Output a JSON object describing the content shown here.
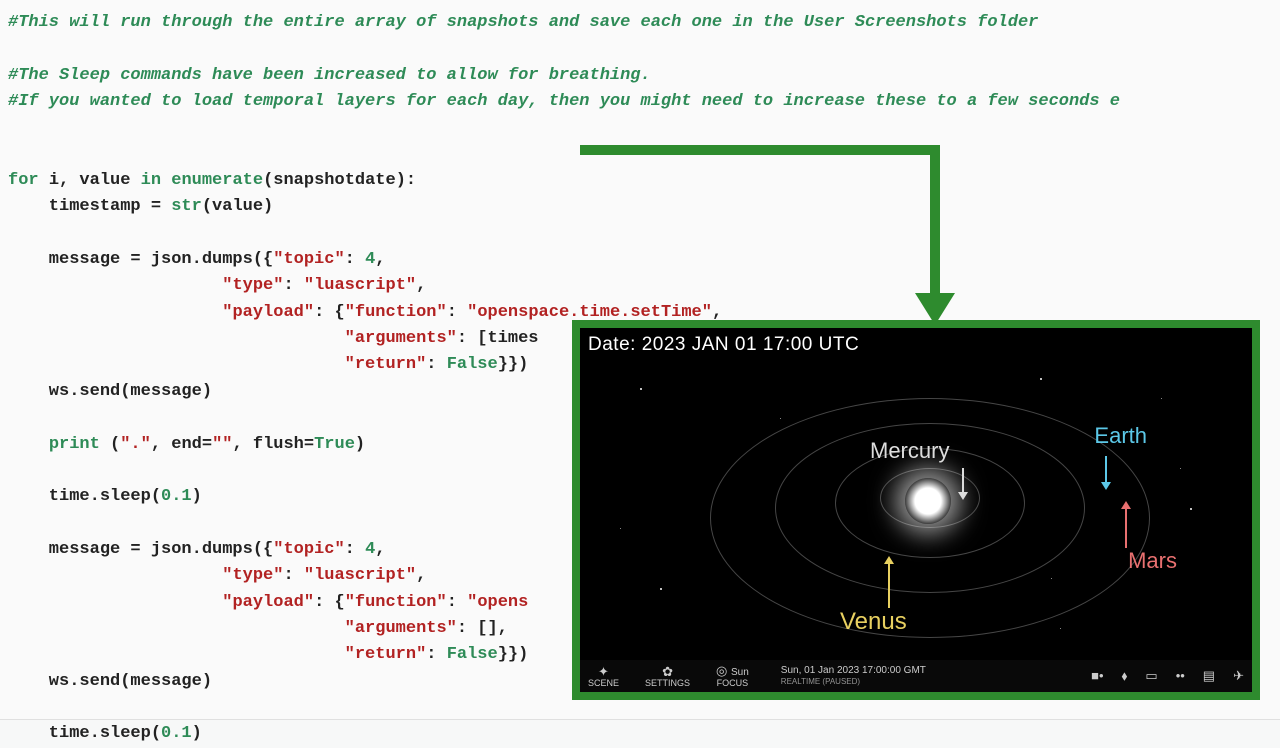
{
  "comments": {
    "c1": "#This will run through the entire array of snapshots and save each one in the User Screenshots folder",
    "c2": "#The Sleep commands have been increased to allow for breathing.",
    "c3": "#If you wanted to load temporal layers for each day, then you might need to increase these to a few seconds e"
  },
  "code": {
    "for_kw": "for",
    "i": "i",
    "comma": ",",
    "value": "value",
    "in_kw": "in",
    "enumerate": "enumerate",
    "snapshotdate": "(snapshotdate):",
    "timestamp_line": "    timestamp = ",
    "str_fn": "str",
    "value_call": "(value)",
    "msg1_a": "    message = json.dumps({",
    "topic_key": "\"topic\"",
    "colon": ": ",
    "four": "4",
    "comma_nl": ",",
    "type_key": "\"type\"",
    "luascript": "\"luascript\"",
    "payload_key": "\"payload\"",
    "function_key": "\"function\"",
    "setTime": "\"openspace.time.setTime\"",
    "arguments_key": "\"arguments\"",
    "timest_frag": ": [times",
    "return_key": "\"return\"",
    "false_kw": "False",
    "close1": "}})",
    "ws_send": "    ws.send(message)",
    "print_a": "    ",
    "print_fn": "print",
    "print_args_a": " (",
    "dot": "\".\"",
    "end_kw": ", end=",
    "empty": "\"\"",
    "flush_kw": ", flush=",
    "true_kw": "True",
    "print_close": ")",
    "sleep_a": "    time.sleep(",
    "sleep_val": "0.1",
    "sleep_close": ")",
    "opensp_frag": "\"opens",
    "args_empty": ": [],"
  },
  "preview": {
    "date_stamp": "Date: 2023 JAN 01  17:00 UTC",
    "labels": {
      "mercury": "Mercury",
      "earth": "Earth",
      "mars": "Mars",
      "venus": "Venus"
    },
    "toolbar": {
      "scene": "SCENE",
      "settings": "SETTINGS",
      "focus": "FOCUS",
      "focus_target": "Sun",
      "time_main": "Sun, 01 Jan 2023 17:00:00 GMT",
      "time_sub": "REALTIME  (PAUSED)"
    }
  }
}
